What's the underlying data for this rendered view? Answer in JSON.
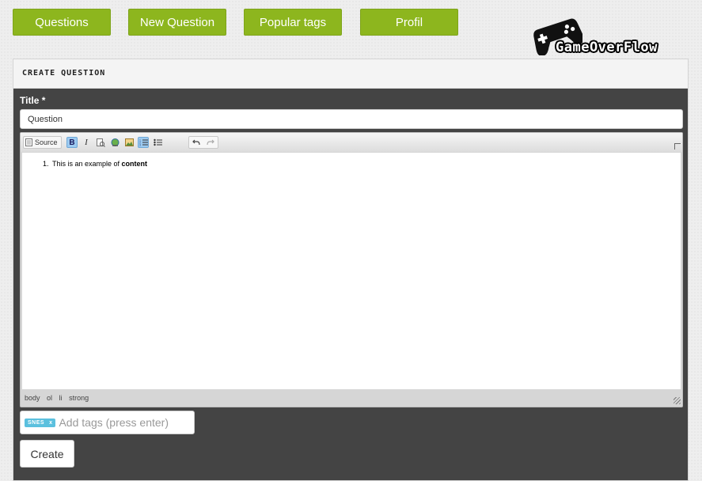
{
  "nav": {
    "questions": "Questions",
    "new_question": "New Question",
    "popular_tags": "Popular tags",
    "profil": "Profil"
  },
  "logo": {
    "text": "GameOverFlow",
    "icon": "gamepad-icon"
  },
  "panel": {
    "header": "Create question",
    "title_label": "Title *",
    "title_value": "Question",
    "editor": {
      "toolbar": {
        "source_label": "Source",
        "icons": [
          "source-icon",
          "bold-icon",
          "italic-icon",
          "preview-icon",
          "link-icon",
          "image-icon",
          "numbered-list-icon",
          "bulleted-list-icon",
          "undo-icon",
          "redo-icon"
        ]
      },
      "content": {
        "text": "This is an example of ",
        "bold": "content"
      },
      "path": [
        "body",
        "ol",
        "li",
        "strong"
      ]
    },
    "tags": {
      "items": [
        {
          "label": "SNES",
          "remove": "x"
        }
      ],
      "placeholder": "Add tags (press enter)"
    },
    "create_label": "Create"
  },
  "colors": {
    "accent": "#8db61e",
    "panel_bg": "#444444",
    "tag": "#5bc0de",
    "active_tool": "#9ccaf0"
  }
}
